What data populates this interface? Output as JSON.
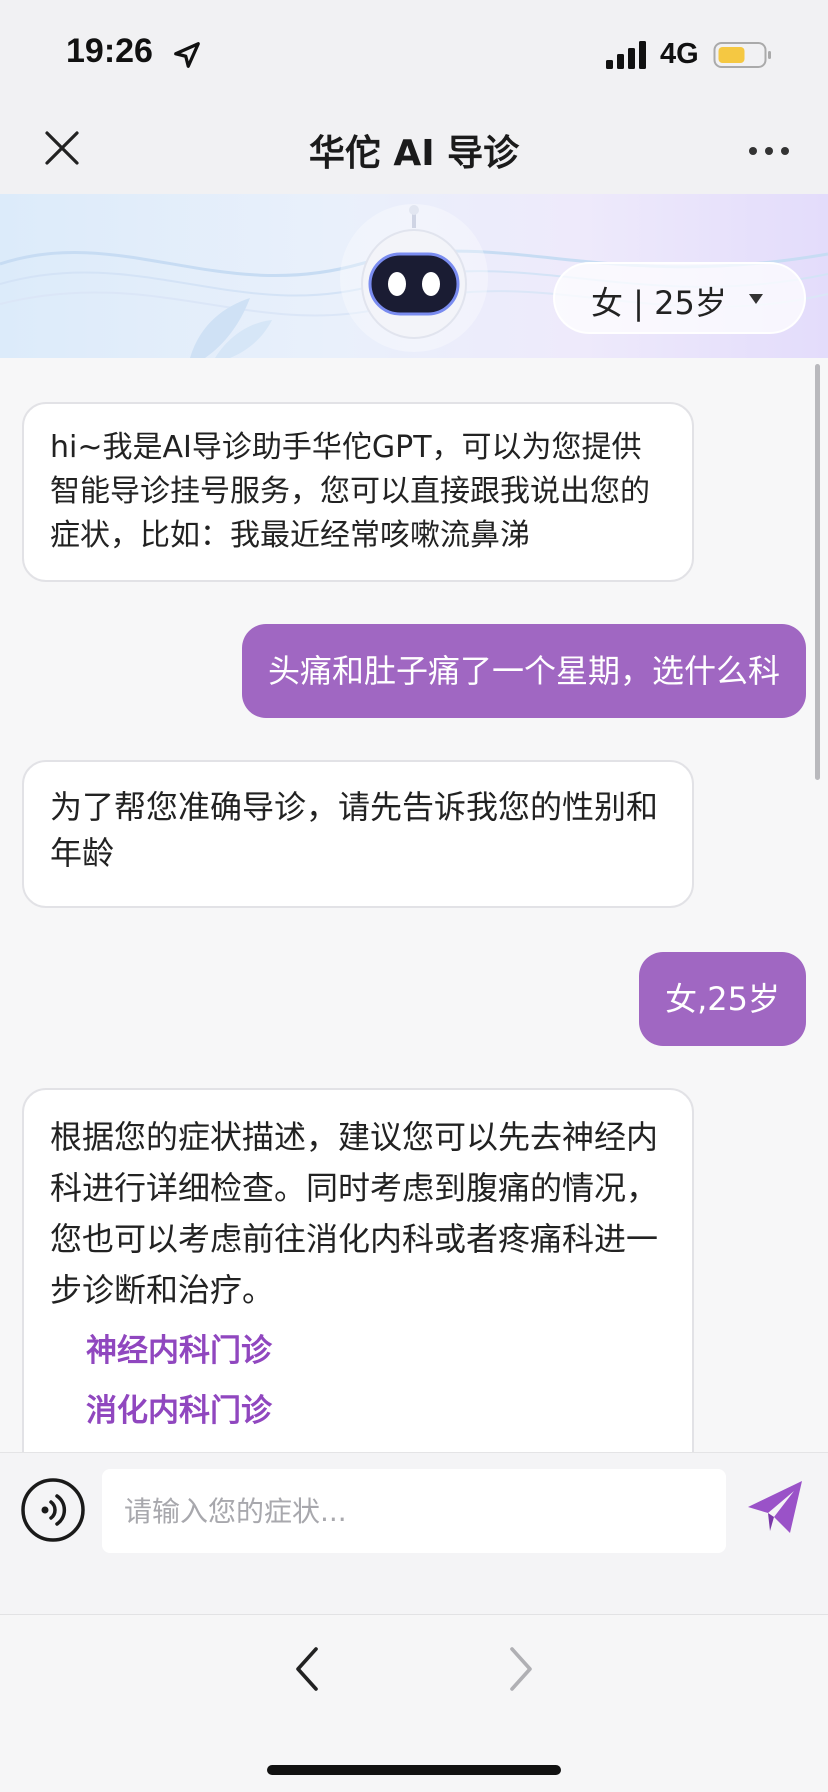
{
  "status_bar": {
    "time": "19:26",
    "network": "4G",
    "icons": [
      "location-arrow-icon",
      "signal-icon",
      "battery-icon"
    ],
    "battery_color": "#f5c842"
  },
  "nav": {
    "title": "华佗 AI 导诊",
    "icons": [
      "close-icon",
      "more-icon"
    ]
  },
  "banner": {
    "profile": "女 | 25岁",
    "icons": [
      "robot-avatar",
      "caret-down-icon"
    ]
  },
  "messages": [
    {
      "role": "bot",
      "text": "hi~我是AI导诊助手华佗GPT，可以为您提供智能导诊挂号服务，您可以直接跟我说出您的症状，比如：我最近经常咳嗽流鼻涕"
    },
    {
      "role": "user",
      "text": "头痛和肚子痛了一个星期，选什么科"
    },
    {
      "role": "bot",
      "text": "为了帮您准确导诊，请先告诉我您的性别和年龄"
    },
    {
      "role": "user",
      "text": "女,25岁"
    },
    {
      "role": "bot",
      "text": "根据您的症状描述，建议您可以先去神经内科进行详细检查。同时考虑到腹痛的情况，您也可以考虑前往消化内科或者疼痛科进一步诊断和治疗。",
      "links": [
        "神经内科门诊",
        "消化内科门诊"
      ]
    }
  ],
  "input": {
    "placeholder": "请输入您的症状...",
    "value": "",
    "icons": [
      "voice-icon",
      "send-icon"
    ]
  },
  "bottom_bar": {
    "icons": [
      "back-icon",
      "forward-icon"
    ]
  },
  "colors": {
    "accent": "#a067c2",
    "link": "#9047bf",
    "bot_bubble_border": "#e2e2e6"
  }
}
